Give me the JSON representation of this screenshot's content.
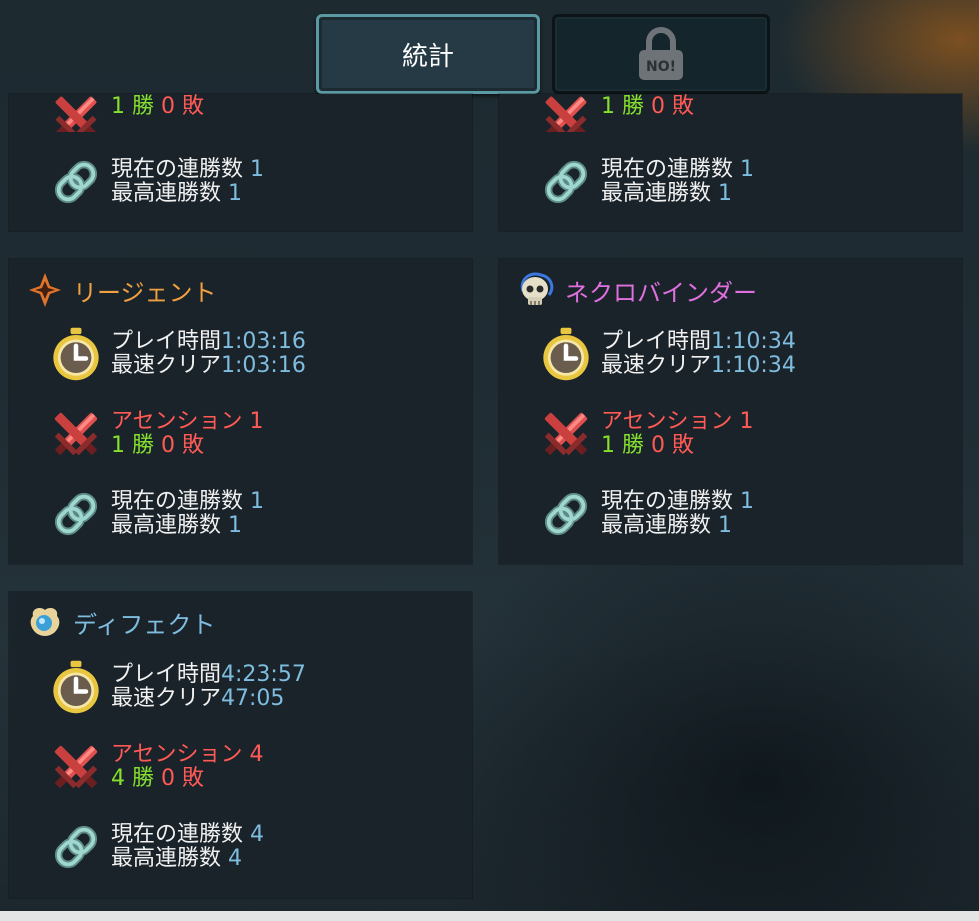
{
  "tabs": {
    "stats_label": "統計",
    "locked_label": "NO!"
  },
  "panels": {
    "top_left": {
      "record": {
        "wins": "1 勝",
        "losses": "0 敗"
      },
      "streak": {
        "current_label": "現在の連勝数",
        "current_value": "1",
        "best_label": "最高連勝数",
        "best_value": "1"
      }
    },
    "top_right": {
      "record": {
        "wins": "1 勝",
        "losses": "0 敗"
      },
      "streak": {
        "current_label": "現在の連勝数",
        "current_value": "1",
        "best_label": "最高連勝数",
        "best_value": "1"
      }
    },
    "regent": {
      "name": "リージェント",
      "name_color": "#f0a040",
      "play_label": "プレイ時間",
      "play_value": "1:03:16",
      "fastest_label": "最速クリア",
      "fastest_value": "1:03:16",
      "ascension_label": "アセンション 1",
      "wins": "1 勝",
      "losses": "0 敗",
      "current_label": "現在の連勝数",
      "current_value": "1",
      "best_label": "最高連勝数",
      "best_value": "1"
    },
    "necrobinder": {
      "name": "ネクロバインダー",
      "name_color": "#e070e0",
      "play_label": "プレイ時間",
      "play_value": "1:10:34",
      "fastest_label": "最速クリア",
      "fastest_value": "1:10:34",
      "ascension_label": "アセンション 1",
      "wins": "1 勝",
      "losses": "0 敗",
      "current_label": "現在の連勝数",
      "current_value": "1",
      "best_label": "最高連勝数",
      "best_value": "1"
    },
    "defect": {
      "name": "ディフェクト",
      "name_color": "#7fbde0",
      "play_label": "プレイ時間",
      "play_value": "4:23:57",
      "fastest_label": "最速クリア",
      "fastest_value": "47:05",
      "ascension_label": "アセンション 4",
      "wins": "4 勝",
      "losses": "0 敗",
      "current_label": "現在の連勝数",
      "current_value": "4",
      "best_label": "最高連勝数",
      "best_value": "4"
    }
  },
  "icons": {
    "timer": "stopwatch-icon",
    "ascension": "crossed-swords-icon",
    "streak": "chain-icon",
    "regent": "regent-star-icon",
    "necrobinder": "skull-icon",
    "defect": "defect-orb-icon",
    "lock": "padlock-icon"
  }
}
